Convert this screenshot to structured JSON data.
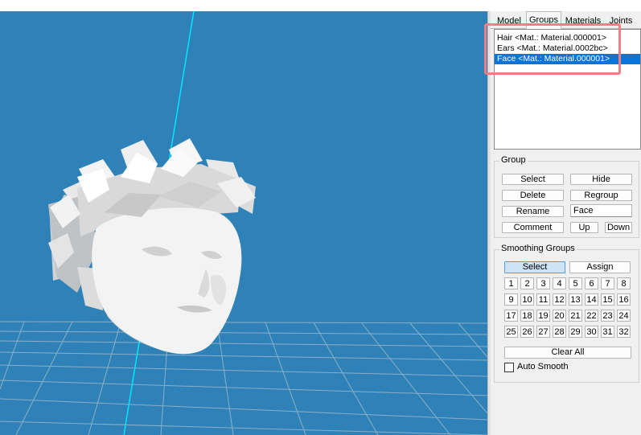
{
  "tabs": [
    {
      "label": "Model",
      "active": false
    },
    {
      "label": "Groups",
      "active": true
    },
    {
      "label": "Materials",
      "active": false
    },
    {
      "label": "Joints",
      "active": false
    }
  ],
  "groups_list": [
    {
      "label": "Hair <Mat.: Material.000001>",
      "selected": false
    },
    {
      "label": "Ears <Mat.: Material.0002bc>",
      "selected": false
    },
    {
      "label": "Face <Mat.: Material.000001>",
      "selected": true
    }
  ],
  "group_section": {
    "title": "Group",
    "select": "Select",
    "hide": "Hide",
    "delete": "Delete",
    "regroup": "Regroup",
    "rename": "Rename",
    "name_value": "Face",
    "comment": "Comment",
    "up": "Up",
    "down": "Down"
  },
  "smoothing_section": {
    "title": "Smoothing Groups",
    "select": "Select",
    "assign": "Assign",
    "numbers": [
      "1",
      "2",
      "3",
      "4",
      "5",
      "6",
      "7",
      "8",
      "9",
      "10",
      "11",
      "12",
      "13",
      "14",
      "15",
      "16",
      "17",
      "18",
      "19",
      "20",
      "21",
      "22",
      "23",
      "24",
      "25",
      "26",
      "27",
      "28",
      "29",
      "30",
      "31",
      "32"
    ],
    "clear_all": "Clear All",
    "auto_smooth": "Auto Smooth",
    "auto_smooth_checked": false
  },
  "colors": {
    "viewport_bg": "#2f82b8",
    "selection": "#0a74d8",
    "annotation": "#f47d83",
    "axis_line": "#00e5ff"
  }
}
